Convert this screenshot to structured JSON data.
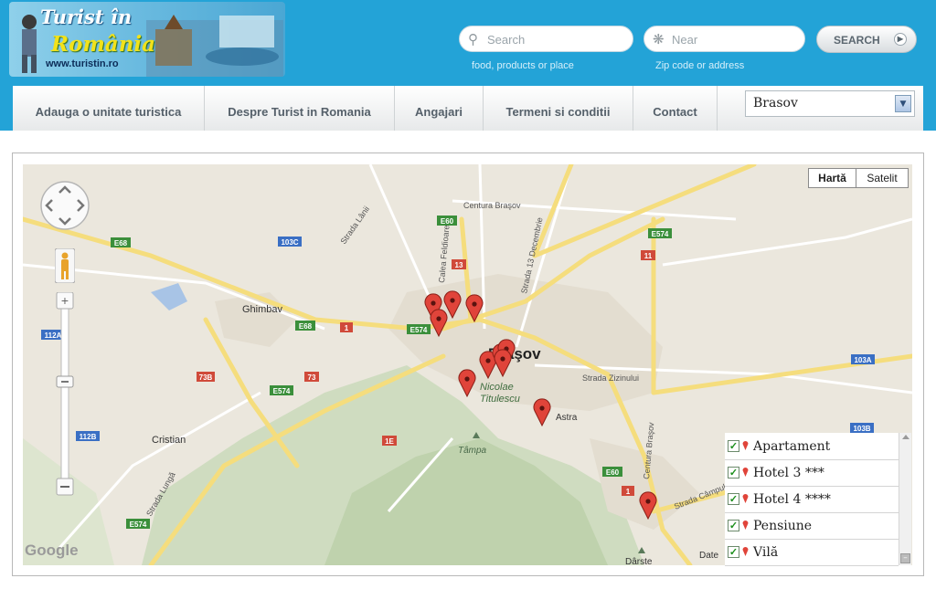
{
  "header": {
    "logo": {
      "title_line1": "Turist în",
      "title_line2": "România",
      "url": "www.turistin.ro"
    },
    "search": {
      "what_placeholder": "Search",
      "what_hint": "food, products or place",
      "near_placeholder": "Near",
      "near_hint": "Zip code or address",
      "button_label": "SEARCH"
    }
  },
  "nav": {
    "items": [
      {
        "label": "Adauga o unitate turistica"
      },
      {
        "label": "Despre Turist in Romania"
      },
      {
        "label": "Angajari"
      },
      {
        "label": "Termeni si conditii"
      },
      {
        "label": "Contact"
      }
    ],
    "city_select": {
      "value": "Brasov"
    }
  },
  "map": {
    "type_buttons": {
      "map": "Hartă",
      "satellite": "Satelit"
    },
    "labels": {
      "city": "Braşov",
      "ghimbav": "Ghimbav",
      "cristian": "Cristian",
      "nicolae": "Nicolae",
      "titulescu": "Titulescu",
      "tampa": "Tâmpa",
      "astra": "Astra",
      "date": "Date",
      "darste": "Dârste",
      "google": "Google"
    },
    "roads": {
      "centura_top": "Centura Braşov",
      "centura_right": "Centura Braşov",
      "strada_13": "Strada 13 Decembrie",
      "calea_feldioarei": "Calea Feldioarei",
      "strada_lanii": "Strada Lânii",
      "strada_zizinului": "Strada Zizinului",
      "strada_lunga": "Strada Lungă",
      "strada_campului": "Strada Câmpului",
      "e68_a": "E68",
      "e68_b": "E68",
      "e574_a": "E574",
      "e574_b": "E574",
      "e574_c": "E574",
      "e574_d": "E574",
      "e60_a": "E60",
      "e60_b": "E60",
      "r103c": "103C",
      "r103a": "103A",
      "r103b": "103B",
      "r112a": "112A",
      "r112b": "112B",
      "r73b": "73B",
      "r73": "73",
      "r1a": "1",
      "r1b": "1",
      "r11": "11",
      "r13": "13",
      "r1e": "1E"
    },
    "legend": [
      {
        "label": "Apartament",
        "checked": true
      },
      {
        "label": "Hotel 3 ***",
        "checked": true
      },
      {
        "label": "Hotel 4 ****",
        "checked": true
      },
      {
        "label": "Pensiune",
        "checked": true
      },
      {
        "label": "Vilă",
        "checked": true
      }
    ],
    "marker_color": "#e0443a",
    "marker_count": 11
  }
}
